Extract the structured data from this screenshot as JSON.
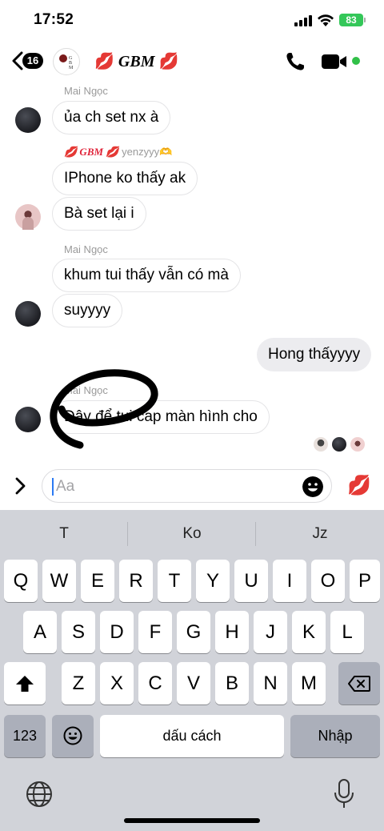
{
  "status_bar": {
    "time": "17:52",
    "battery": "83"
  },
  "header": {
    "unread_count": "16",
    "group_name": "GBM",
    "title_decoration": "💋",
    "avatar_text": "GBM"
  },
  "messages": [
    {
      "sender": "Mai Ngọc",
      "text": "ủa ch set nx à",
      "direction": "incoming"
    },
    {
      "sender_prefix": "💋 GBM 💋",
      "sender": "yenzyyy🫶",
      "text": "IPhone ko thấy ak",
      "direction": "incoming"
    },
    {
      "text": "Bà set lại i",
      "direction": "incoming"
    },
    {
      "sender": "Mai Ngọc",
      "text": "khum tui thấy vẫn có mà",
      "direction": "incoming"
    },
    {
      "text": "suyyyy",
      "direction": "incoming"
    },
    {
      "text": "Hong thấyyyy",
      "direction": "outgoing"
    },
    {
      "sender": "Mai Ngọc",
      "text": "Đây để tui cap màn hình cho",
      "direction": "incoming"
    }
  ],
  "composer": {
    "placeholder": "Aa",
    "send_reaction": "💋"
  },
  "keyboard": {
    "suggestions": [
      "T",
      "Ko",
      "Jz"
    ],
    "row1": [
      "Q",
      "W",
      "E",
      "R",
      "T",
      "Y",
      "U",
      "I",
      "O",
      "P"
    ],
    "row2": [
      "A",
      "S",
      "D",
      "F",
      "G",
      "H",
      "J",
      "K",
      "L"
    ],
    "row3": [
      "Z",
      "X",
      "C",
      "V",
      "B",
      "N",
      "M"
    ],
    "numbers_label": "123",
    "space_label": "dấu cách",
    "return_label": "Nhập"
  },
  "colors": {
    "accent": "#2a7af3",
    "online": "#31c048",
    "battery": "#34c759",
    "reaction": "#e0243a"
  }
}
